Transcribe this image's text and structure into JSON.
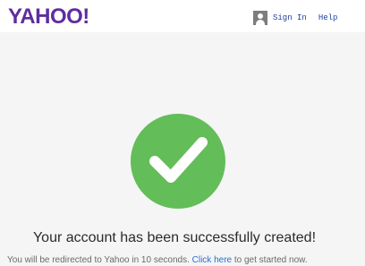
{
  "header": {
    "logo": "YAHOO!",
    "sign_in_label": "Sign In",
    "help_label": "Help"
  },
  "icons": {
    "user": "user-icon",
    "success": "checkmark-icon"
  },
  "colors": {
    "brand": "#5f2d9e",
    "success": "#63bd59",
    "link": "#2a6fcf"
  },
  "main": {
    "title": "Your account has been successfully created!",
    "message_prefix": "You will be redirected to Yahoo in 10 seconds.",
    "click_here": "Click here",
    "message_suffix": "to get started now."
  }
}
